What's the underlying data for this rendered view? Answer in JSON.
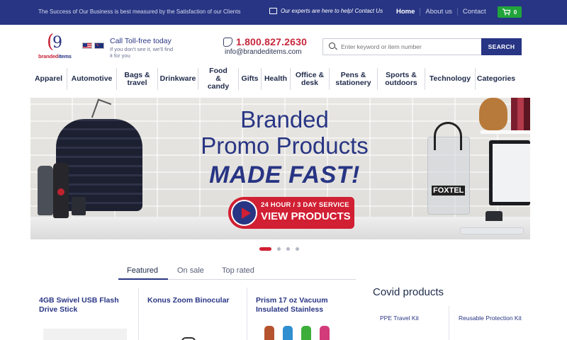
{
  "topbar": {
    "tagline": "The Success of Our Business is best measured by the Satisfaction of our Clients",
    "experts": "Our experts are here to help! Contact Us",
    "nav": [
      "Home",
      "About us",
      "Contact"
    ],
    "cart_count": "0"
  },
  "logo": {
    "brand_red": "branded",
    "brand_blue": "items"
  },
  "header": {
    "call_title": "Call Toll-free today",
    "call_sub": "If you don't see it, we'll find it for you",
    "phone": "1.800.827.2630",
    "email": "info@brandeditems.com",
    "search_placeholder": "Enter keyword or item number",
    "search_button": "SEARCH"
  },
  "categories": [
    "Apparel",
    "Automotive",
    "Bags & travel",
    "Drinkware",
    "Food & candy",
    "Gifts",
    "Health",
    "Office & desk",
    "Pens & stationery",
    "Sports & outdoors",
    "Technology",
    "Categories"
  ],
  "hero": {
    "line1": "Branded",
    "line2": "Promo Products",
    "line3": "MADE FAST!",
    "cta_top": "24 HOUR / 3 DAY SERVICE",
    "cta_main": "VIEW PRODUCTS",
    "tote_brand": "FOXTEL"
  },
  "tabs": [
    "Featured",
    "On sale",
    "Top rated"
  ],
  "products": [
    {
      "name": "4GB Swivel USB Flash Drive Stick"
    },
    {
      "name": "Konus Zoom Binocular"
    },
    {
      "name": "Prism 17 oz Vacuum Insulated Stainless"
    }
  ],
  "covid": {
    "title": "Covid products",
    "items": [
      "PPE Travel Kit",
      "Reusable Protection Kit"
    ]
  },
  "colors": {
    "brand_navy": "#283584",
    "brand_red": "#c7263b",
    "cta_red": "#d11f33",
    "cart_green": "#21a53a"
  }
}
